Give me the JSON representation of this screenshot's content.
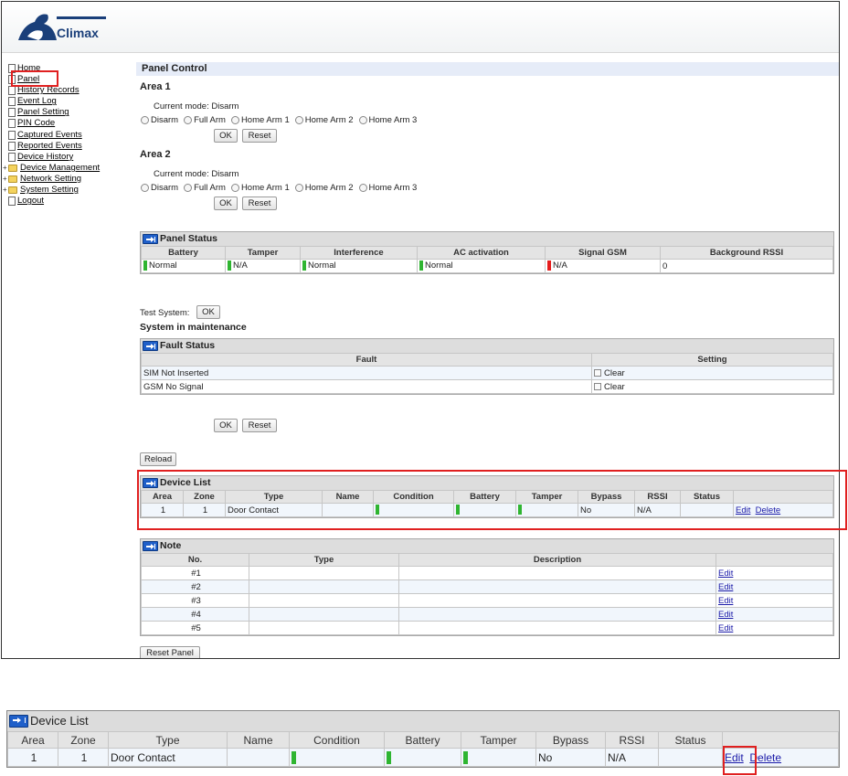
{
  "brand": {
    "name": "Climax"
  },
  "nav": {
    "items": [
      {
        "label": "Home",
        "folder": false
      },
      {
        "label": "Panel",
        "folder": false
      },
      {
        "label": "History Records",
        "folder": false
      },
      {
        "label": "Event Log",
        "folder": false
      },
      {
        "label": "Panel Setting",
        "folder": false
      },
      {
        "label": "PIN Code",
        "folder": false
      },
      {
        "label": "Captured Events",
        "folder": false
      },
      {
        "label": "Reported Events",
        "folder": false
      },
      {
        "label": "Device History",
        "folder": false
      },
      {
        "label": "Device Management",
        "folder": true
      },
      {
        "label": "Network Setting",
        "folder": true
      },
      {
        "label": "System Setting",
        "folder": true
      },
      {
        "label": "Logout",
        "folder": false
      }
    ]
  },
  "panel_control": {
    "title": "Panel Control",
    "areas": [
      {
        "title": "Area 1",
        "current_mode_label": "Current mode:",
        "current_mode": "Disarm",
        "options": [
          "Disarm",
          "Full Arm",
          "Home Arm 1",
          "Home Arm 2",
          "Home Arm 3"
        ]
      },
      {
        "title": "Area 2",
        "current_mode_label": "Current mode:",
        "current_mode": "Disarm",
        "options": [
          "Disarm",
          "Full Arm",
          "Home Arm 1",
          "Home Arm 2",
          "Home Arm 3"
        ]
      }
    ],
    "ok_label": "OK",
    "reset_label": "Reset"
  },
  "panel_status": {
    "title": "Panel Status",
    "columns": [
      "Battery",
      "Tamper",
      "Interference",
      "AC activation",
      "Signal GSM",
      "Background RSSI"
    ],
    "row": [
      {
        "value": "Normal",
        "indicator": "green"
      },
      {
        "value": "N/A",
        "indicator": "green"
      },
      {
        "value": "Normal",
        "indicator": "green"
      },
      {
        "value": "Normal",
        "indicator": "green"
      },
      {
        "value": "N/A",
        "indicator": "red"
      },
      {
        "value": "0",
        "indicator": ""
      }
    ]
  },
  "test_system": {
    "label": "Test System:",
    "button": "OK"
  },
  "maintenance": "System in maintenance",
  "fault_status": {
    "title": "Fault Status",
    "columns": [
      "Fault",
      "Setting"
    ],
    "rows": [
      {
        "fault": "SIM Not Inserted",
        "setting": "Clear"
      },
      {
        "fault": "GSM No Signal",
        "setting": "Clear"
      }
    ],
    "ok_label": "OK",
    "reset_label": "Reset"
  },
  "reload_label": "Reload",
  "device_list": {
    "title": "Device List",
    "columns": [
      "Area",
      "Zone",
      "Type",
      "Name",
      "Condition",
      "Battery",
      "Tamper",
      "Bypass",
      "RSSI",
      "Status",
      ""
    ],
    "rows": [
      {
        "area": "1",
        "zone": "1",
        "type": "Door Contact",
        "name": "",
        "bypass": "No",
        "rssi": "N/A",
        "status": "",
        "edit": "Edit",
        "delete": "Delete"
      }
    ]
  },
  "note": {
    "title": "Note",
    "columns": [
      "No.",
      "Type",
      "Description",
      ""
    ],
    "rows": [
      {
        "no": "#1",
        "edit": "Edit"
      },
      {
        "no": "#2",
        "edit": "Edit"
      },
      {
        "no": "#3",
        "edit": "Edit"
      },
      {
        "no": "#4",
        "edit": "Edit"
      },
      {
        "no": "#5",
        "edit": "Edit"
      }
    ]
  },
  "reset_panel_label": "Reset Panel",
  "colors": {
    "highlight": "#e02020",
    "ok_indicator": "#2fb531",
    "fault_indicator": "#e51c1c",
    "link": "#1a1aa8"
  }
}
